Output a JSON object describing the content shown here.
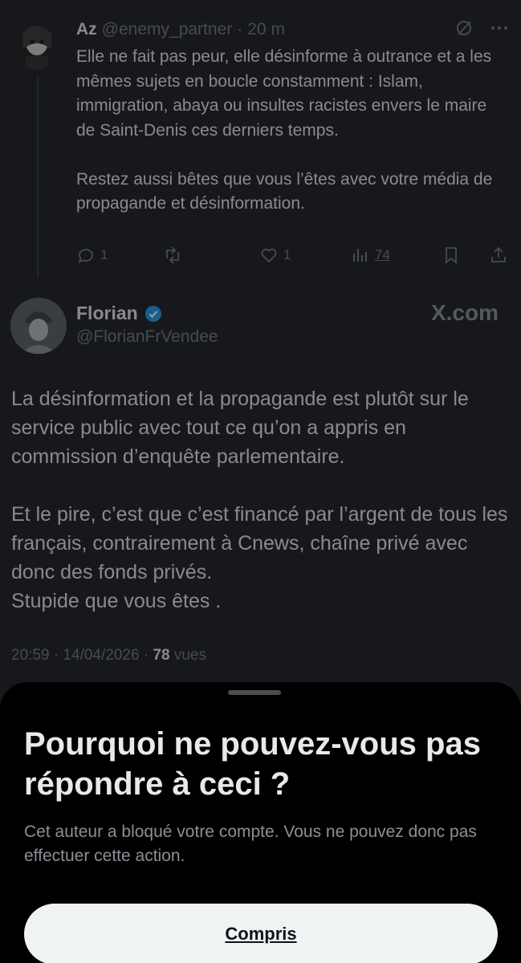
{
  "reply_tweet": {
    "author_name": "Az",
    "author_handle": "@enemy_partner",
    "separator": "·",
    "time": "20 m",
    "text": "Elle ne fait pas peur, elle désinforme à outrance et a les mêmes sujets en boucle constamment : Islam, immigration, abaya ou insultes racistes envers le maire de Saint-Denis ces derniers temps.\n\nRestez aussi bêtes que vous l’êtes avec votre média de propagande et désinformation.",
    "reply_count": "1",
    "like_count": "1",
    "view_count": "74",
    "icons": [
      "grok-icon",
      "more-icon",
      "reply-icon",
      "retweet-icon",
      "like-icon",
      "views-icon",
      "bookmark-icon",
      "share-icon"
    ]
  },
  "main_tweet": {
    "author_name": "Florian",
    "author_handle": "@FlorianFrVendee",
    "verified": true,
    "watermark": "X.com",
    "text": "La désinformation et la propagande est plutôt sur le service public avec tout ce qu’on a appris en commission d’enquête parlementaire.\n\nEt le pire, c’est que c’est financé par l’argent de tous les français, contrairement à Cnews, chaîne privé avec donc des fonds privés.\nStupide que vous êtes .",
    "timestamp": "20:59 · 14/04/2026 · ",
    "views": "78",
    "views_label": " vues"
  },
  "sheet": {
    "title": "Pourquoi ne pouvez-vous pas répondre à ceci ?",
    "body": "Cet auteur a bloqué votre compte. Vous ne pouvez donc pas effectuer cette action.",
    "button_label": "Compris"
  },
  "colors": {
    "background": "#16181c",
    "sheet": "#000000",
    "verified": "#1d9bf0",
    "button": "#eff3f4"
  }
}
